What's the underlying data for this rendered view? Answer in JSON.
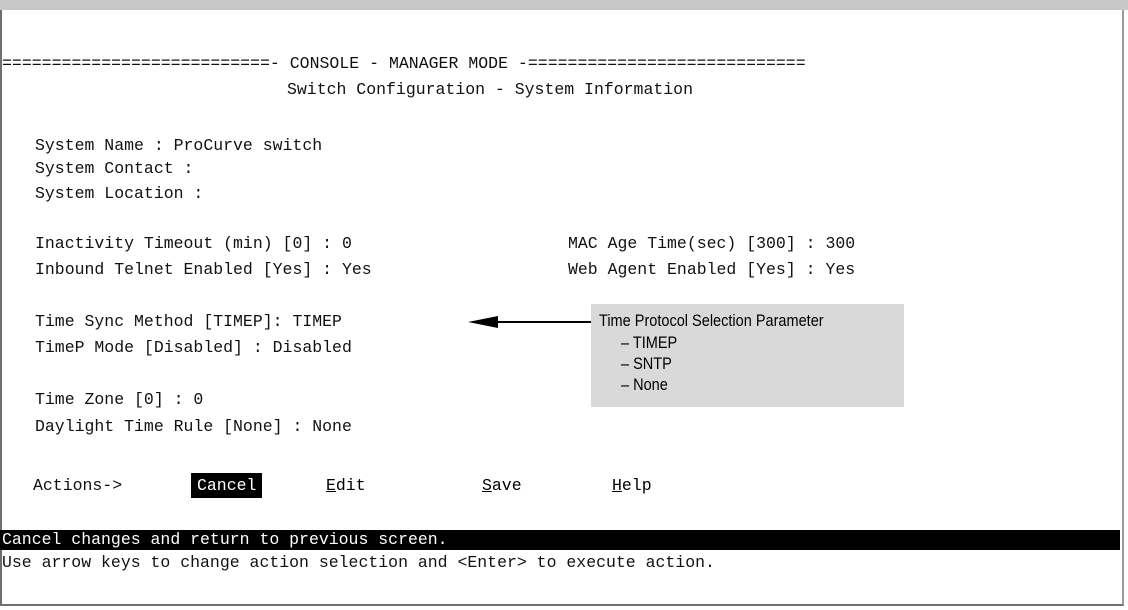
{
  "console": {
    "banner": "===========================- CONSOLE - MANAGER MODE -============================",
    "title": "Switch Configuration - System Information"
  },
  "fields": {
    "system_name": "System Name : ProCurve switch",
    "system_contact": "System Contact :",
    "system_location": "System Location :",
    "inactivity_timeout": "Inactivity Timeout (min) [0] : 0",
    "mac_age_time": "MAC Age Time(sec) [300] : 300",
    "inbound_telnet": "Inbound Telnet Enabled [Yes] : Yes",
    "web_agent": "Web Agent Enabled [Yes] : Yes",
    "time_sync_method": "Time Sync Method [TIMEP]: TIMEP",
    "timep_mode": "TimeP Mode [Disabled] : Disabled",
    "time_zone": "Time Zone [0] : 0",
    "daylight_time_rule": "Daylight Time Rule [None] : None"
  },
  "actions": {
    "label": "Actions->",
    "cancel": "Cancel",
    "edit_hot": "E",
    "edit_rest": "dit",
    "save_hot": "S",
    "save_rest": "ave",
    "help_hot": "H",
    "help_rest": "elp"
  },
  "status": {
    "message": "Cancel changes and return to previous screen.",
    "hint": "Use arrow keys to change action selection and <Enter> to execute action."
  },
  "callout": {
    "title": "Time Protocol Selection Parameter",
    "items": [
      "–  TIMEP",
      "–  SNTP",
      "–  None"
    ]
  }
}
